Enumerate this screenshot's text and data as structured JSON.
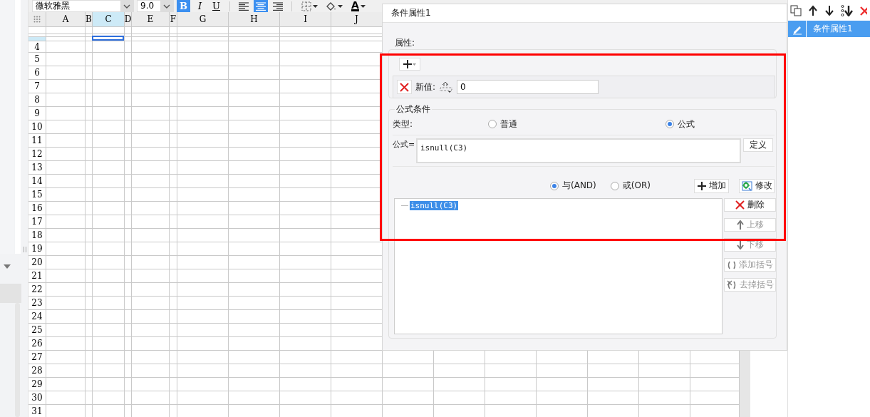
{
  "toolbar": {
    "font": "微软雅黑",
    "size": "9.0",
    "buttons": [
      {
        "kind": "bold",
        "label": "B",
        "selected": true
      },
      {
        "kind": "italic",
        "label": "I",
        "selected": false
      },
      {
        "kind": "underline",
        "label": "U",
        "selected": false
      },
      {
        "kind": "align-left",
        "selected": false
      },
      {
        "kind": "align-center",
        "selected": true
      },
      {
        "kind": "align-right",
        "selected": false
      },
      {
        "kind": "borders"
      },
      {
        "kind": "fill-color"
      },
      {
        "kind": "font-color",
        "label": "A"
      }
    ]
  },
  "sheet": {
    "columns": [
      {
        "label": "A",
        "selected": false
      },
      {
        "label": "B",
        "selected": false
      },
      {
        "label": "C",
        "selected": true
      },
      {
        "label": "D",
        "selected": false
      },
      {
        "label": "E",
        "selected": false
      },
      {
        "label": "F",
        "selected": false
      },
      {
        "label": "G",
        "selected": false
      },
      {
        "label": "H",
        "selected": false
      },
      {
        "label": "I",
        "selected": false
      },
      {
        "label": "J",
        "selected": false
      }
    ],
    "rows": [
      "4",
      "5",
      "6",
      "7",
      "8",
      "9",
      "10",
      "11",
      "12",
      "13",
      "14",
      "15",
      "16",
      "17",
      "18",
      "19",
      "20",
      "21",
      "22",
      "23",
      "24",
      "25",
      "26",
      "27",
      "28",
      "29",
      "30",
      "31"
    ]
  },
  "dialog": {
    "title": "条件属性1",
    "property_label": "属性:",
    "new_value": {
      "label": "新值:",
      "value": "0"
    },
    "formula_condition": {
      "title": "公式条件",
      "type_label": "类型:",
      "types": [
        {
          "label": "普通",
          "selected": false
        },
        {
          "label": "公式",
          "selected": true
        }
      ],
      "formula_label": "公式=",
      "formula": "isnull(C3)",
      "define_button": "定义",
      "logic": [
        {
          "label": "与(AND)",
          "selected": true
        },
        {
          "label": "或(OR)",
          "selected": false
        }
      ],
      "add_button": "增加",
      "modify_button": "修改",
      "conditions": [
        {
          "text": "isnull(C3)",
          "selected": true
        }
      ],
      "actions": [
        {
          "kind": "delete",
          "label": "删除",
          "disabled": false
        },
        {
          "kind": "up",
          "label": "上移",
          "disabled": true
        },
        {
          "kind": "down",
          "label": "下移",
          "disabled": true
        },
        {
          "kind": "add-brackets",
          "label": "添加括号",
          "disabled": true
        },
        {
          "kind": "remove-brackets",
          "label": "去掉括号",
          "disabled": true
        }
      ]
    }
  },
  "properties_panel": {
    "items": [
      {
        "label": "条件属性1",
        "selected": true
      }
    ]
  }
}
